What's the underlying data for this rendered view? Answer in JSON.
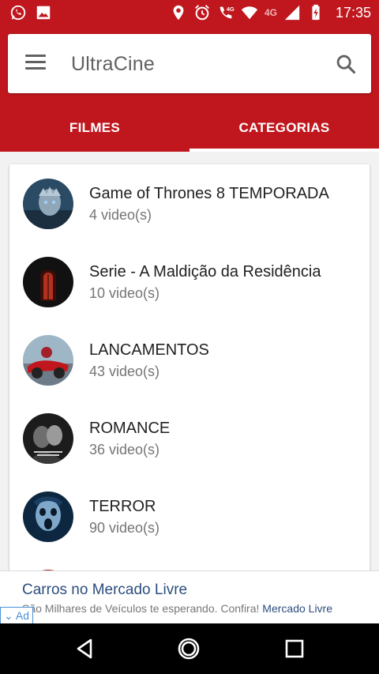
{
  "status_bar": {
    "time": "17:35",
    "network": "4G",
    "icons": [
      "whatsapp-icon",
      "image-icon",
      "location-icon",
      "alarm-icon",
      "wifi-call-icon",
      "wifi-icon",
      "signal-icon",
      "battery-icon"
    ]
  },
  "header": {
    "app_title": "UltraCine",
    "menu_icon": "hamburger-menu-icon",
    "search_icon": "search-icon"
  },
  "tabs": [
    {
      "label": "FILMES",
      "selected": false
    },
    {
      "label": "CATEGORIAS",
      "selected": true
    }
  ],
  "categories": [
    {
      "title": "Game of Thrones 8 TEMPORADA",
      "count": "4 video(s)"
    },
    {
      "title": "Serie - A Maldição da Residência",
      "count": "10 video(s)"
    },
    {
      "title": "LANCAMENTOS",
      "count": "43 video(s)"
    },
    {
      "title": "ROMANCE",
      "count": "36 video(s)"
    },
    {
      "title": "TERROR",
      "count": "90 video(s)"
    }
  ],
  "ad": {
    "title": "Carros no Mercado Livre",
    "description": "São Milhares de Veículos te esperando. Confira!",
    "link": "Mercado Livre",
    "badge": "Ad"
  },
  "navigation": {
    "icons": [
      "back-icon",
      "home-icon",
      "recents-icon"
    ]
  },
  "colors": {
    "primary": "#c0171e",
    "accent": "#ffffff"
  }
}
